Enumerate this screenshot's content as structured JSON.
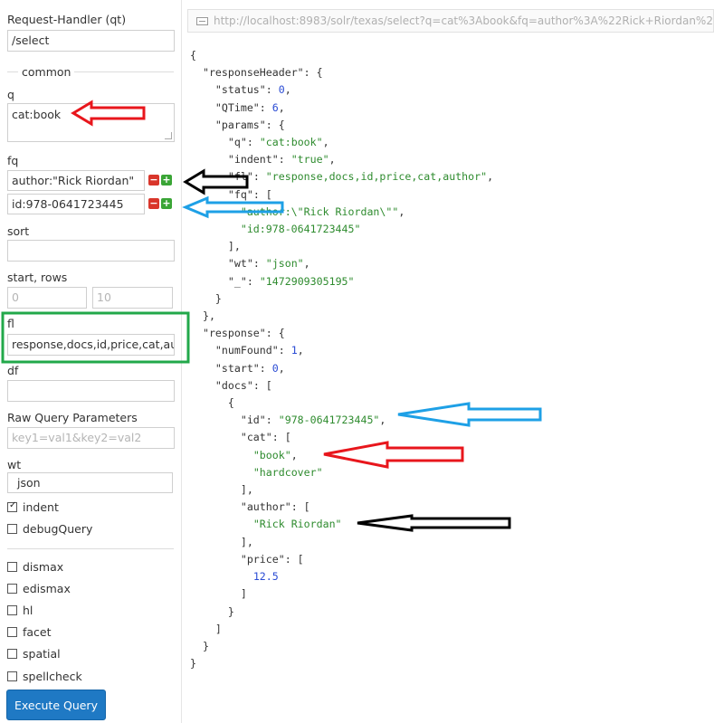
{
  "form": {
    "handler_label": "Request-Handler (qt)",
    "handler_value": "/select",
    "common_legend": "common",
    "q_label": "q",
    "q_value": "cat:book",
    "fq_label": "fq",
    "fq_values": [
      "author:\"Rick Riordan\"",
      "id:978-0641723445"
    ],
    "sort_label": "sort",
    "sort_value": "",
    "start_rows_label": "start, rows",
    "start_placeholder": "0",
    "rows_placeholder": "10",
    "fl_label": "fl",
    "fl_value": "response,docs,id,price,cat,aut",
    "df_label": "df",
    "df_value": "",
    "raw_label": "Raw Query Parameters",
    "raw_placeholder": "key1=val1&key2=val2",
    "wt_label": "wt",
    "wt_value": "json",
    "indent_label": "indent",
    "indent_checked": true,
    "debug_label": "debugQuery",
    "options": [
      "dismax",
      "edismax",
      "hl",
      "facet",
      "spatial",
      "spellcheck"
    ],
    "execute_label": "Execute Query"
  },
  "url": "http://localhost:8983/solr/texas/select?q=cat%3Abook&fq=author%3A%22Rick+Riordan%2",
  "minus_symbol": "−",
  "plus_symbol": "+",
  "colors": {
    "red_arrow": "#e8161c",
    "black_arrow": "#000000",
    "blue_arrow": "#1ea0e6",
    "green_box": "#22a84a",
    "json_string": "#2e8b2e",
    "json_number": "#2a4bd4",
    "button": "#1f79c4"
  },
  "json_lines": [
    [
      [
        "p",
        "{"
      ]
    ],
    [
      [
        "p",
        "  "
      ],
      [
        "k",
        "\"responseHeader\""
      ],
      [
        "p",
        ": {"
      ]
    ],
    [
      [
        "p",
        "    "
      ],
      [
        "k",
        "\"status\""
      ],
      [
        "p",
        ": "
      ],
      [
        "n",
        "0"
      ],
      [
        "p",
        ","
      ]
    ],
    [
      [
        "p",
        "    "
      ],
      [
        "k",
        "\"QTime\""
      ],
      [
        "p",
        ": "
      ],
      [
        "n",
        "6"
      ],
      [
        "p",
        ","
      ]
    ],
    [
      [
        "p",
        "    "
      ],
      [
        "k",
        "\"params\""
      ],
      [
        "p",
        ": {"
      ]
    ],
    [
      [
        "p",
        "      "
      ],
      [
        "k",
        "\"q\""
      ],
      [
        "p",
        ": "
      ],
      [
        "s",
        "\"cat:book\""
      ],
      [
        "p",
        ","
      ]
    ],
    [
      [
        "p",
        "      "
      ],
      [
        "k",
        "\"indent\""
      ],
      [
        "p",
        ": "
      ],
      [
        "s",
        "\"true\""
      ],
      [
        "p",
        ","
      ]
    ],
    [
      [
        "p",
        "      "
      ],
      [
        "k",
        "\"fl\""
      ],
      [
        "p",
        ": "
      ],
      [
        "s",
        "\"response,docs,id,price,cat,author\""
      ],
      [
        "p",
        ","
      ]
    ],
    [
      [
        "p",
        "      "
      ],
      [
        "k",
        "\"fq\""
      ],
      [
        "p",
        ": ["
      ]
    ],
    [
      [
        "p",
        "        "
      ],
      [
        "s",
        "\"author:\\\"Rick Riordan\\\"\""
      ],
      [
        "p",
        ","
      ]
    ],
    [
      [
        "p",
        "        "
      ],
      [
        "s",
        "\"id:978-0641723445\""
      ]
    ],
    [
      [
        "p",
        "      ],"
      ]
    ],
    [
      [
        "p",
        "      "
      ],
      [
        "k",
        "\"wt\""
      ],
      [
        "p",
        ": "
      ],
      [
        "s",
        "\"json\""
      ],
      [
        "p",
        ","
      ]
    ],
    [
      [
        "p",
        "      "
      ],
      [
        "k",
        "\"_\""
      ],
      [
        "p",
        ": "
      ],
      [
        "s",
        "\"1472909305195\""
      ]
    ],
    [
      [
        "p",
        "    }"
      ]
    ],
    [
      [
        "p",
        "  },"
      ]
    ],
    [
      [
        "p",
        "  "
      ],
      [
        "k",
        "\"response\""
      ],
      [
        "p",
        ": {"
      ]
    ],
    [
      [
        "p",
        "    "
      ],
      [
        "k",
        "\"numFound\""
      ],
      [
        "p",
        ": "
      ],
      [
        "n",
        "1"
      ],
      [
        "p",
        ","
      ]
    ],
    [
      [
        "p",
        "    "
      ],
      [
        "k",
        "\"start\""
      ],
      [
        "p",
        ": "
      ],
      [
        "n",
        "0"
      ],
      [
        "p",
        ","
      ]
    ],
    [
      [
        "p",
        "    "
      ],
      [
        "k",
        "\"docs\""
      ],
      [
        "p",
        ": ["
      ]
    ],
    [
      [
        "p",
        "      {"
      ]
    ],
    [
      [
        "p",
        "        "
      ],
      [
        "k",
        "\"id\""
      ],
      [
        "p",
        ": "
      ],
      [
        "s",
        "\"978-0641723445\""
      ],
      [
        "p",
        ","
      ]
    ],
    [
      [
        "p",
        "        "
      ],
      [
        "k",
        "\"cat\""
      ],
      [
        "p",
        ": ["
      ]
    ],
    [
      [
        "p",
        "          "
      ],
      [
        "s",
        "\"book\""
      ],
      [
        "p",
        ","
      ]
    ],
    [
      [
        "p",
        "          "
      ],
      [
        "s",
        "\"hardcover\""
      ]
    ],
    [
      [
        "p",
        "        ],"
      ]
    ],
    [
      [
        "p",
        "        "
      ],
      [
        "k",
        "\"author\""
      ],
      [
        "p",
        ": ["
      ]
    ],
    [
      [
        "p",
        "          "
      ],
      [
        "s",
        "\"Rick Riordan\""
      ]
    ],
    [
      [
        "p",
        "        ],"
      ]
    ],
    [
      [
        "p",
        "        "
      ],
      [
        "k",
        "\"price\""
      ],
      [
        "p",
        ": ["
      ]
    ],
    [
      [
        "p",
        "          "
      ],
      [
        "n",
        "12.5"
      ]
    ],
    [
      [
        "p",
        "        ]"
      ]
    ],
    [
      [
        "p",
        "      }"
      ]
    ],
    [
      [
        "p",
        "    ]"
      ]
    ],
    [
      [
        "p",
        "  }"
      ]
    ],
    [
      [
        "p",
        "}"
      ]
    ]
  ]
}
